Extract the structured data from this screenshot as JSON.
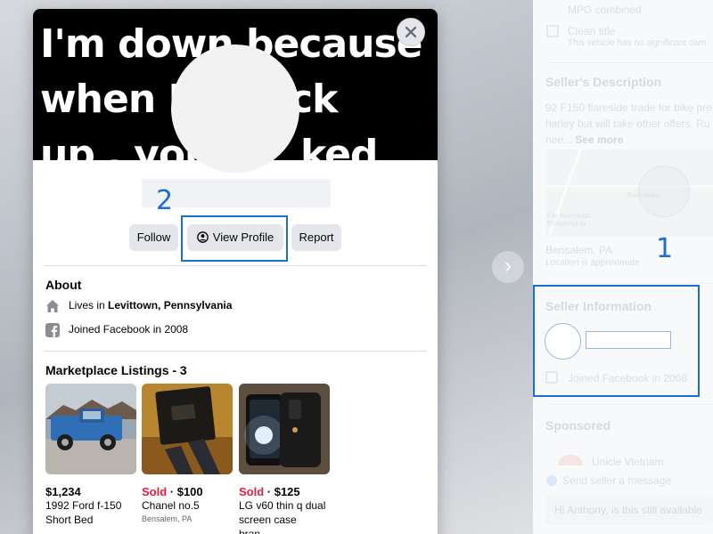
{
  "cover": {
    "lines": [
      "I'm down because",
      "when I",
      "ck",
      "up , you",
      "ked"
    ]
  },
  "profile_card": {
    "buttons": {
      "follow": "Follow",
      "view_profile": "View Profile",
      "report": "Report"
    },
    "about": {
      "heading": "About",
      "lives_prefix": "Lives in ",
      "lives_city": "Levittown, Pennsylvania",
      "joined": "Joined Facebook in 2008"
    },
    "listings": {
      "heading": "Marketplace Listings - 3",
      "items": [
        {
          "sold": "",
          "price": "$1,234",
          "title": "1992 Ford f-150 Short Bed",
          "location": ""
        },
        {
          "sold": "Sold",
          "price": " · $100",
          "title": "Chanel no.5",
          "location": "Bensalem, PA"
        },
        {
          "sold": "Sold",
          "price": " · $125",
          "title": "LG v60 thin q dual screen case bran...",
          "location": ""
        }
      ]
    }
  },
  "right_pane": {
    "mpg_label": "MPG combined",
    "clean_title": "Clean title",
    "clean_title_sub": "This vehicle has no significant dam",
    "description_heading": "Seller's Description",
    "description_text": "92 F150 flareside trade for bike pre harley but will take other offers. Ru nee...",
    "see_more": "See more",
    "map_labels": {
      "town": "Bensalem",
      "area": "Far Northeast Philadelphia"
    },
    "location": "Bensalem, PA",
    "location_note": "Location is approximate",
    "seller_info_heading": "Seller Information",
    "seller_joined": "Joined Facebook in 2008",
    "sponsored_heading": "Sponsored",
    "sponsor_name": "Unicle Vietnam",
    "send_message": "Send seller a message",
    "message_placeholder": "Hi Anthony, is this still available"
  },
  "annotations": {
    "step1": "1",
    "step2": "2",
    "color": "#1a6fd6"
  },
  "icons": [
    "close-icon",
    "user-circle-icon",
    "home-icon",
    "facebook-icon",
    "chevron-right-icon",
    "messenger-icon"
  ]
}
